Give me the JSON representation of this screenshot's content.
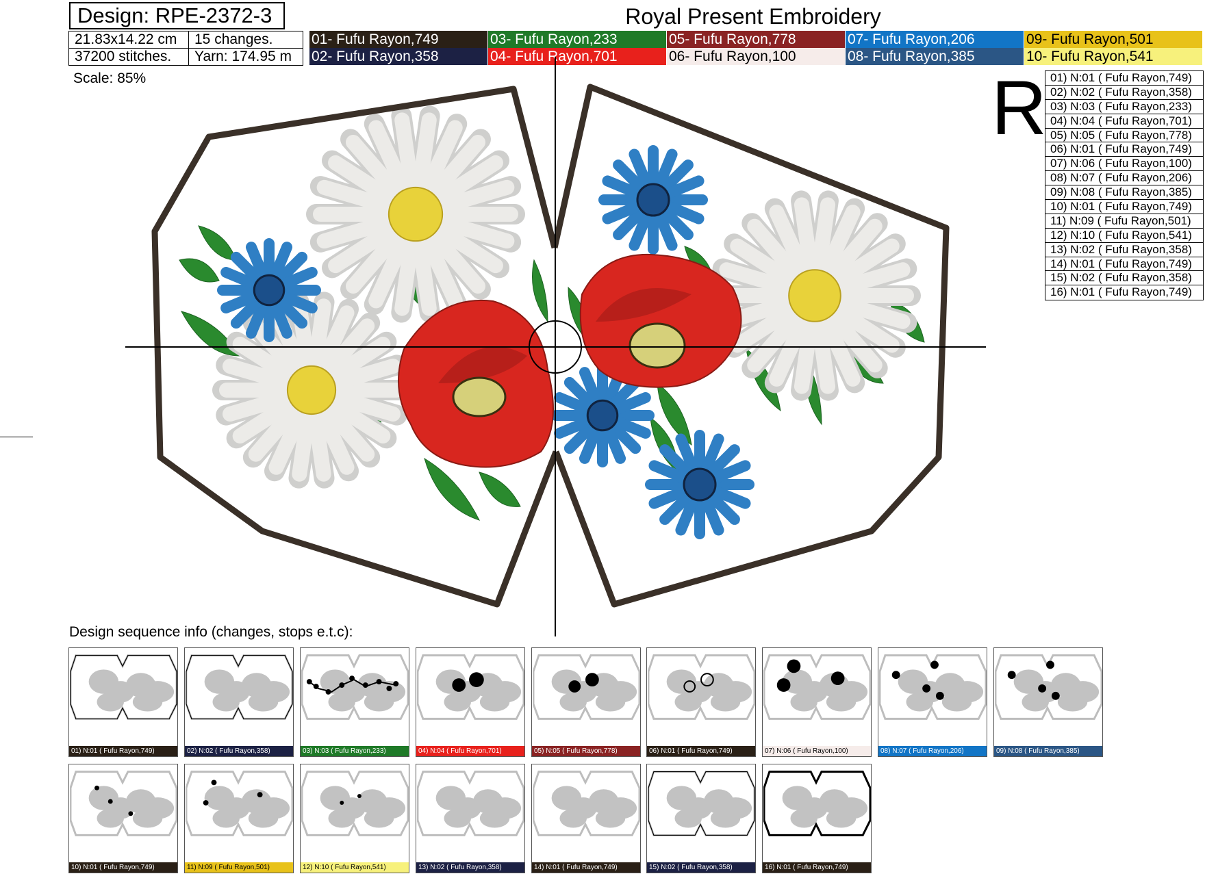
{
  "design_label": "Design: RPE-2372-3",
  "brand": "Royal Present Embroidery",
  "info": {
    "size": "21.83x14.22 cm",
    "changes": "15 changes.",
    "stitches": "37200 stitches.",
    "yarn": "Yarn: 174.95 m"
  },
  "threads": [
    {
      "label": "01- Fufu Rayon,749",
      "color": "#2a2016",
      "text_color": "#ffffff"
    },
    {
      "label": "02- Fufu Rayon,358",
      "color": "#1c2144",
      "text_color": "#ffffff"
    },
    {
      "label": "03- Fufu Rayon,233",
      "color": "#1f7a28",
      "text_color": "#ffffff"
    },
    {
      "label": "04- Fufu Rayon,701",
      "color": "#e8211c",
      "text_color": "#ffffff"
    },
    {
      "label": "05- Fufu Rayon,778",
      "color": "#8a2323",
      "text_color": "#ffffff"
    },
    {
      "label": "06- Fufu Rayon,100",
      "color": "#f6ecea",
      "text_color": "#000000"
    },
    {
      "label": "07- Fufu Rayon,206",
      "color": "#1275c6",
      "text_color": "#ffffff"
    },
    {
      "label": "08- Fufu Rayon,385",
      "color": "#2b5685",
      "text_color": "#ffffff"
    },
    {
      "label": "09- Fufu Rayon,501",
      "color": "#e8c21a",
      "text_color": "#000000"
    },
    {
      "label": "10- Fufu Rayon,541",
      "color": "#f7f17c",
      "text_color": "#000000"
    }
  ],
  "scale_label": "Scale: 85%",
  "big_letter": "R",
  "stops": [
    "01) N:01 ( Fufu Rayon,749)",
    "02) N:02 ( Fufu Rayon,358)",
    "03) N:03 ( Fufu Rayon,233)",
    "04) N:04 ( Fufu Rayon,701)",
    "05) N:05 ( Fufu Rayon,778)",
    "06) N:01 ( Fufu Rayon,749)",
    "07) N:06 ( Fufu Rayon,100)",
    "08) N:07 ( Fufu Rayon,206)",
    "09) N:08 ( Fufu Rayon,385)",
    "10) N:01 ( Fufu Rayon,749)",
    "11) N:09 ( Fufu Rayon,501)",
    "12) N:10 ( Fufu Rayon,541)",
    "13) N:02 ( Fufu Rayon,358)",
    "14) N:01 ( Fufu Rayon,749)",
    "15) N:02 ( Fufu Rayon,358)",
    "16) N:01 ( Fufu Rayon,749)"
  ],
  "sequence_title": "Design sequence info (changes, stops e.t.c):",
  "sequence": [
    {
      "label": "01) N:01 ( Fufu Rayon,749)",
      "color": "#2a2016",
      "text_color": "#ffffff",
      "step": "outline-thin"
    },
    {
      "label": "02) N:02 ( Fufu Rayon,358)",
      "color": "#1c2144",
      "text_color": "#ffffff",
      "step": "outline-thin"
    },
    {
      "label": "03) N:03 ( Fufu Rayon,233)",
      "color": "#1f7a28",
      "text_color": "#ffffff",
      "step": "leaves"
    },
    {
      "label": "04) N:04 ( Fufu Rayon,701)",
      "color": "#e8211c",
      "text_color": "#ffffff",
      "step": "poppies"
    },
    {
      "label": "05) N:05 ( Fufu Rayon,778)",
      "color": "#8a2323",
      "text_color": "#ffffff",
      "step": "poppy-detail"
    },
    {
      "label": "06) N:01 ( Fufu Rayon,749)",
      "color": "#2a2016",
      "text_color": "#ffffff",
      "step": "poppy-outline"
    },
    {
      "label": "07) N:06 ( Fufu Rayon,100)",
      "color": "#f6ecea",
      "text_color": "#000000",
      "step": "daisies"
    },
    {
      "label": "08) N:07 ( Fufu Rayon,206)",
      "color": "#1275c6",
      "text_color": "#ffffff",
      "step": "cornflowers"
    },
    {
      "label": "09) N:08 ( Fufu Rayon,385)",
      "color": "#2b5685",
      "text_color": "#ffffff",
      "step": "cornflower-detail"
    },
    {
      "label": "10) N:01 ( Fufu Rayon,749)",
      "color": "#2a2016",
      "text_color": "#ffffff",
      "step": "small-dots"
    },
    {
      "label": "11) N:09 ( Fufu Rayon,501)",
      "color": "#e8c21a",
      "text_color": "#000000",
      "step": "daisy-centers"
    },
    {
      "label": "12) N:10 ( Fufu Rayon,541)",
      "color": "#f7f17c",
      "text_color": "#000000",
      "step": "poppy-centers"
    },
    {
      "label": "13) N:02 ( Fufu Rayon,358)",
      "color": "#1c2144",
      "text_color": "#ffffff",
      "step": "none"
    },
    {
      "label": "14) N:01 ( Fufu Rayon,749)",
      "color": "#2a2016",
      "text_color": "#ffffff",
      "step": "none"
    },
    {
      "label": "15) N:02 ( Fufu Rayon,358)",
      "color": "#1c2144",
      "text_color": "#ffffff",
      "step": "outline-thin"
    },
    {
      "label": "16) N:01 ( Fufu Rayon,749)",
      "color": "#2a2016",
      "text_color": "#ffffff",
      "step": "outline-bold"
    }
  ],
  "colors": {
    "frame": "#3a3028",
    "daisy_petal": "#ecebe8",
    "daisy_center": "#e8d23a",
    "cornflower": "#2f7fc4",
    "poppy": "#d8261f",
    "leaf": "#2a8a2e",
    "poppy_center": "#d6d07a"
  }
}
